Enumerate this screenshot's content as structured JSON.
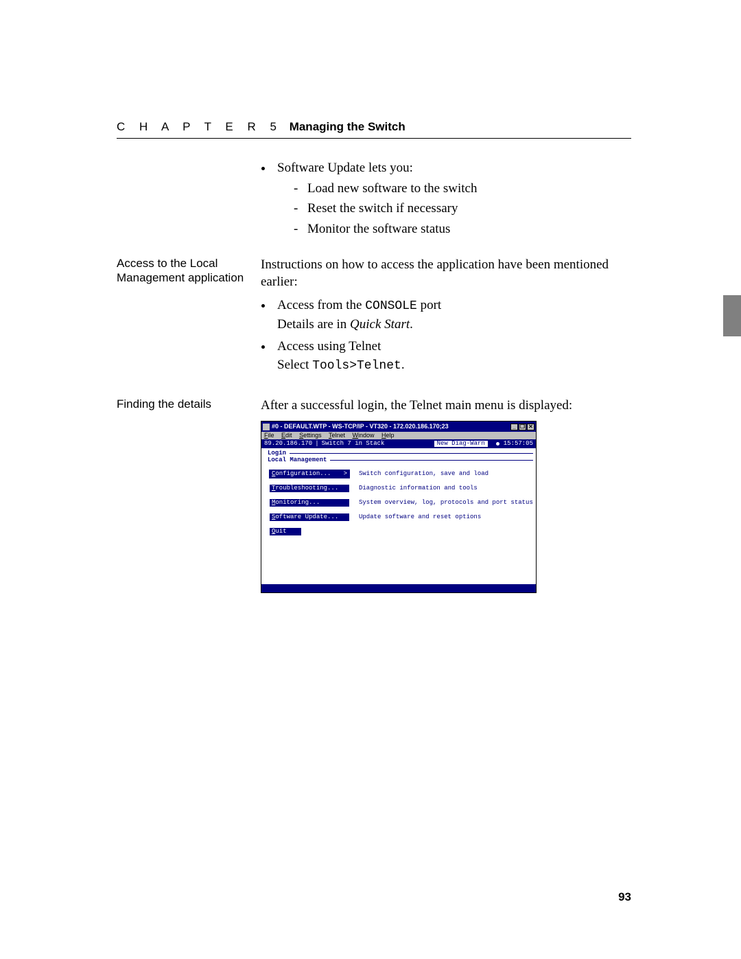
{
  "header": {
    "chapter_label": "C H A P T E R 5",
    "chapter_title": "Managing the Switch"
  },
  "page_number": "93",
  "section_sw_update": {
    "intro": "Software Update lets you:",
    "items": [
      "Load new software to the switch",
      "Reset the switch if necessary",
      "Monitor the software status"
    ]
  },
  "section_access": {
    "margin": "Access to the Local Management application",
    "intro": "Instructions on how to access the application have been mentioned earlier:",
    "b1_pre": "Access from the ",
    "b1_code": "CONSOLE",
    "b1_post": " port",
    "b1_sub_pre": "Details are in ",
    "b1_sub_ital": "Quick Start",
    "b1_sub_post": ".",
    "b2": "Access using Telnet",
    "b2_sub_pre": "Select ",
    "b2_sub_code": "Tools>Telnet",
    "b2_sub_post": "."
  },
  "section_finding": {
    "margin": "Finding the details",
    "text": "After a successful login, the Telnet main menu is displayed:"
  },
  "shot": {
    "title": "#0 - DEFAULT.WTP - WS-TCP/IP - VT320 - 172.020.186.170;23",
    "menus": {
      "file": "File",
      "edit": "Edit",
      "settings": "Settings",
      "telnet": "Telnet",
      "window": "Window",
      "help": "Help"
    },
    "termhead": {
      "ip": "89.20.186.170",
      "title": "Switch 7 in Stack",
      "alarm": "New Diag-Warn",
      "time": "15:57:05"
    },
    "frame1": "Login",
    "frame2": "Local Management",
    "menu": [
      {
        "label": "Configuration...",
        "desc": "Switch configuration, save and load",
        "selected": true,
        "arrow": true
      },
      {
        "label": "Troubleshooting...",
        "desc": "Diagnostic information and tools"
      },
      {
        "label": "Monitoring...",
        "desc": "System overview, log, protocols and port status"
      },
      {
        "label": "Software Update...",
        "desc": "Update software and reset options"
      },
      {
        "label": "Quit",
        "desc": ""
      }
    ],
    "winbtn_min": "_",
    "winbtn_max": "❐",
    "winbtn_close": "✕"
  }
}
